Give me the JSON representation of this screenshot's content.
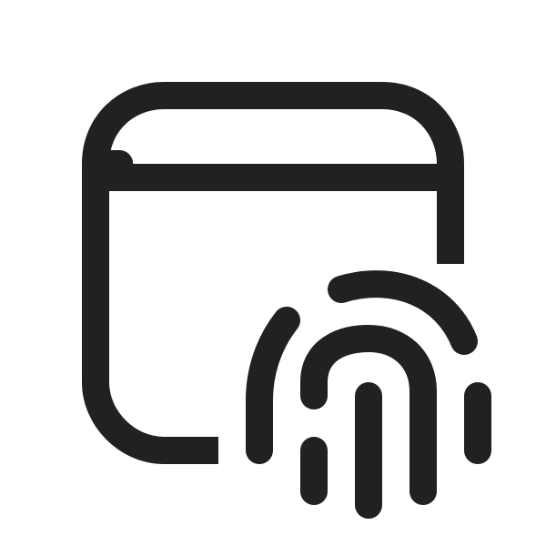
{
  "icon": {
    "name": "window-fingerprint-icon",
    "color": "#212121",
    "background": "#ffffff"
  }
}
